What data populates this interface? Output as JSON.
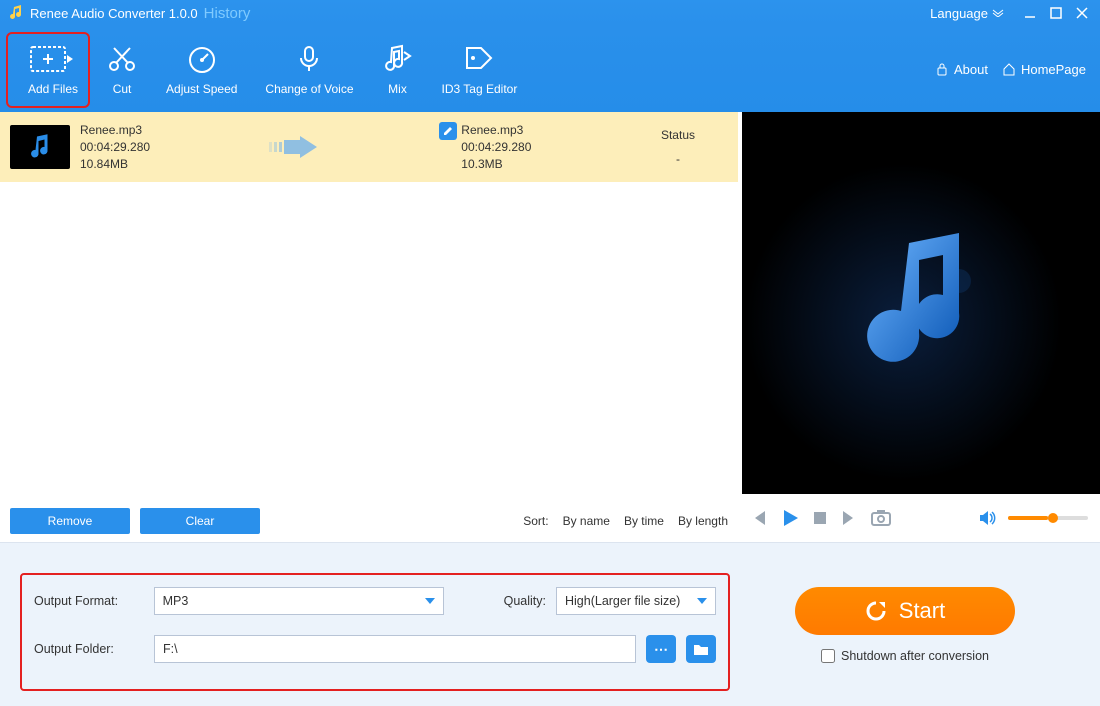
{
  "titlebar": {
    "title": "Renee Audio Converter 1.0.0",
    "history": "History",
    "language": "Language"
  },
  "toolbar": {
    "add_files": "Add Files",
    "cut": "Cut",
    "adjust_speed": "Adjust Speed",
    "change_voice": "Change of Voice",
    "mix": "Mix",
    "id3": "ID3 Tag Editor",
    "about": "About",
    "homepage": "HomePage"
  },
  "file": {
    "src_name": "Renee.mp3",
    "src_duration": "00:04:29.280",
    "src_size": "10.84MB",
    "dst_name": "Renee.mp3",
    "dst_duration": "00:04:29.280",
    "dst_size": "10.3MB",
    "status_label": "Status",
    "status_value": "-"
  },
  "buttons": {
    "remove": "Remove",
    "clear": "Clear"
  },
  "sort": {
    "label": "Sort:",
    "by_name": "By name",
    "by_time": "By time",
    "by_length": "By length"
  },
  "settings": {
    "format_label": "Output Format:",
    "format_value": "MP3",
    "quality_label": "Quality:",
    "quality_value": "High(Larger file size)",
    "folder_label": "Output Folder:",
    "folder_value": "F:\\"
  },
  "start": "Start",
  "shutdown": "Shutdown after conversion"
}
